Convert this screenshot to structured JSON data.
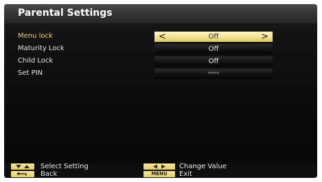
{
  "header": {
    "title": "Parental Settings"
  },
  "settings": [
    {
      "label": "Menu lock",
      "value": "Off",
      "selected": true
    },
    {
      "label": "Maturity Lock",
      "value": "Off",
      "selected": false
    },
    {
      "label": "Child Lock",
      "value": "Off",
      "selected": false
    },
    {
      "label": "Set PIN",
      "value": "****",
      "selected": false
    }
  ],
  "arrows": {
    "left": "<",
    "right": ">"
  },
  "footer": {
    "select_setting": "Select Setting",
    "back": "Back",
    "change_value": "Change Value",
    "menu_key": "MENU",
    "exit": "Exit"
  },
  "colors": {
    "selection_highlight": "#f2e18f",
    "selected_label": "#f2d36a"
  }
}
